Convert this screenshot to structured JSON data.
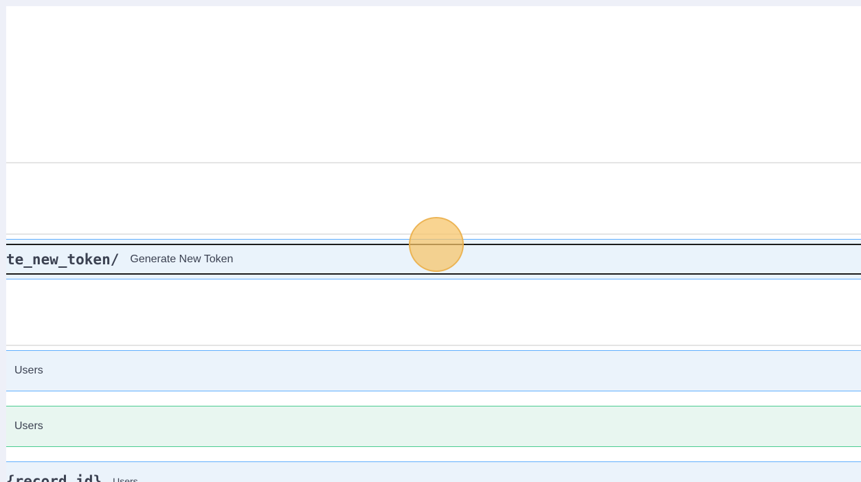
{
  "operations": [
    {
      "path": "te_new_token/",
      "summary": "Generate New Token",
      "method_color": "#61affe",
      "focused": true
    },
    {
      "path": "",
      "summary": "Users",
      "method_color": "#61affe"
    },
    {
      "path": "",
      "summary": "Users",
      "method_color": "#49cc90"
    },
    {
      "path": "{record_id}",
      "summary": "Users",
      "method_color": "#61affe"
    }
  ],
  "colors": {
    "page_background": "#eef0f8",
    "get_border": "#61affe",
    "post_border": "#49cc90",
    "click_marker": "#f6c466"
  }
}
